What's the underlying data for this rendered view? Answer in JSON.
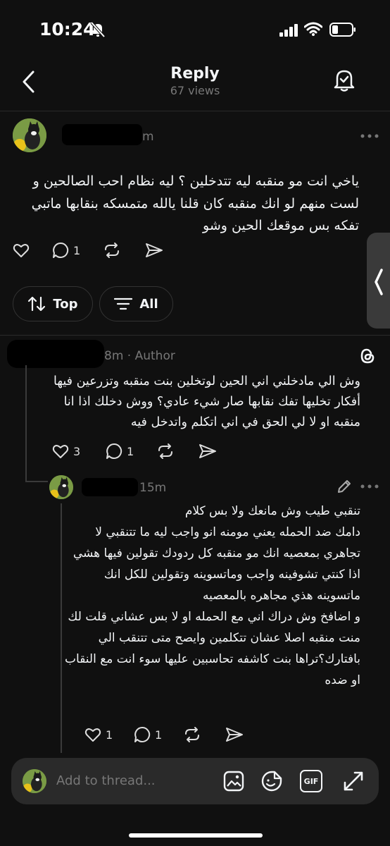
{
  "status_bar": {
    "time": "10:24"
  },
  "header": {
    "title": "Reply",
    "views": "67 views"
  },
  "post1": {
    "username_tail": "m",
    "text": "ياخي انت مو منقبه ليه تتدخلين ؟ ليه نظام احب الصالحين و لست منهم لو انك منقبه كان قلنا يالله متمسكه بنقابها ماتبي تفكه بس موقعك الحين وشو",
    "reply_count": "1"
  },
  "sort": {
    "top_label": "Top",
    "all_label": "All"
  },
  "post2": {
    "username_tail": "8m",
    "meta": "· Author",
    "text": "وش الي مادخلني اني الحين لوتخلين بنت منقبه وتزرعين فيها أفكار تخليها تفك نقابها صار شيء عادي؟ ووش دخلك اذا انا منقبه او لا لي الحق في اني اتكلم واتدخل فيه",
    "like_count": "3",
    "reply_count": "1"
  },
  "post3": {
    "username_tail": "15m",
    "line1": "تنقبي طيب وش مانعك ولا بس كلام",
    "line2": "دامك ضد الحمله يعني مومنه انو واجب ليه ما تتنقبي لا تجاهري بمعصيه انك مو منقبه كل ردودك تقولين فيها هشي اذا كنتي تشوفينه واجب وماتسوينه وتقولين للكل انك ماتسوينه هذي مجاهره بالمعصيه",
    "line3": "و اضافخ وش دراك اني مع الحمله او لا بس عشاني قلت لك منت منقبه اصلا عشان تتكلمين وايصح متى تتنقب الي بافتارك؟تراها بنت كاشفه تحاسبين عليها سوء انت مع النقاب او ضده",
    "like_count": "1",
    "reply_count": "1"
  },
  "composer": {
    "placeholder": "Add to thread...",
    "gif_label": "GIF"
  },
  "colors": {
    "background": "#101010",
    "text": "#f3f5f7",
    "muted": "#777777",
    "composer_bg": "#2a2a2a"
  }
}
